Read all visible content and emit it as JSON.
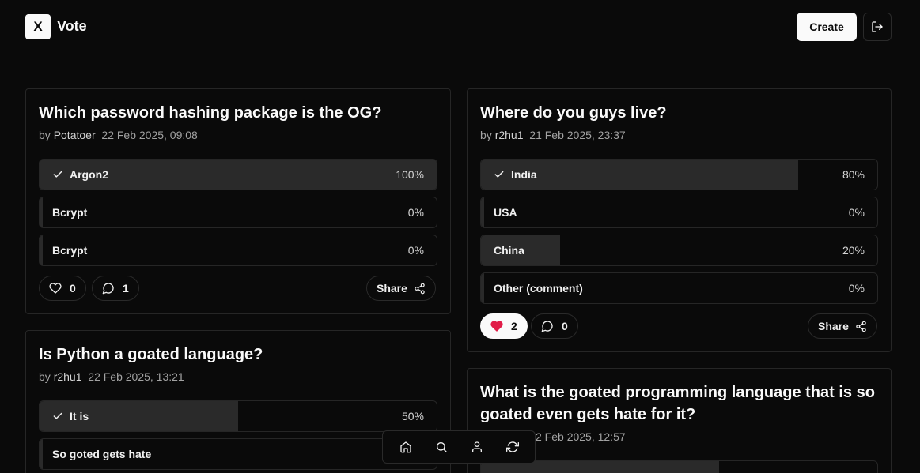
{
  "app": {
    "logo": "X",
    "title": "Vote"
  },
  "header": {
    "create_label": "Create",
    "logout_icon": "logout-icon"
  },
  "polls": [
    {
      "title": "Which password hashing package is the OG?",
      "by": "by",
      "author": "Potatoer",
      "date": "22 Feb 2025, 09:08",
      "options": [
        {
          "label": "Argon2",
          "pct": "100%",
          "fill": 1.0,
          "selected": true
        },
        {
          "label": "Bcrypt",
          "pct": "0%",
          "fill": 0,
          "selected": false
        },
        {
          "label": "Bcrypt",
          "pct": "0%",
          "fill": 0,
          "selected": false
        }
      ],
      "likes": "0",
      "comments": "1",
      "share_label": "Share",
      "liked": false
    },
    {
      "title": "Where do you guys live?",
      "by": "by",
      "author": "r2hu1",
      "date": "21 Feb 2025, 23:37",
      "options": [
        {
          "label": "India",
          "pct": "80%",
          "fill": 0.8,
          "selected": true
        },
        {
          "label": "USA",
          "pct": "0%",
          "fill": 0,
          "selected": false
        },
        {
          "label": "China",
          "pct": "20%",
          "fill": 0.2,
          "selected": false
        },
        {
          "label": "Other (comment)",
          "pct": "0%",
          "fill": 0,
          "selected": false
        }
      ],
      "likes": "2",
      "comments": "0",
      "share_label": "Share",
      "liked": true
    },
    {
      "title": "Is Python a goated language?",
      "by": "by",
      "author": "r2hu1",
      "date": "22 Feb 2025, 13:21",
      "options": [
        {
          "label": "It is",
          "pct": "50%",
          "fill": 0.5,
          "selected": true
        },
        {
          "label": "So goted gets hate",
          "pct": "",
          "fill": 0,
          "selected": false
        }
      ]
    },
    {
      "title_line1": "What is the goated programming language that is so",
      "title_line2": "goated even gets hate for it?",
      "date": "2 Feb 2025, 12:57"
    }
  ],
  "bottom_nav": [
    "home-icon",
    "search-icon",
    "user-icon",
    "refresh-icon"
  ],
  "colors": {
    "bg": "#0a0a0a",
    "border": "#262626",
    "fill": "#2a2a2a",
    "heart": "#e11d48"
  }
}
